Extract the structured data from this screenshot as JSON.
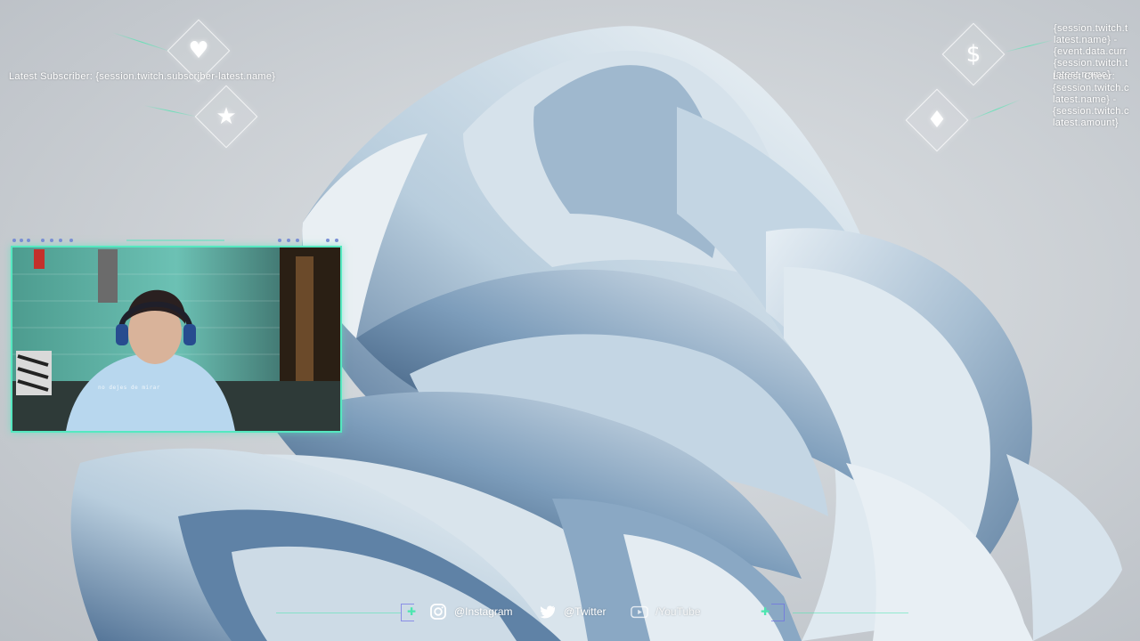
{
  "overlay": {
    "latest_subscriber": "Latest Subscriber: {session.twitch.subscriber-latest.name}",
    "top_right_lines": [
      "{session.twitch.t",
      "latest.name} -",
      "{event.data.curr",
      "{session.twitch.t",
      "latest.name}"
    ],
    "latest_cheer_lines": [
      "Latest Cheer:",
      "{session.twitch.c",
      "latest.name} -",
      "{session.twitch.c",
      "latest.amount}"
    ],
    "icons": {
      "follower": "heart-icon",
      "subscriber": "star-icon",
      "donation": "dollar-icon",
      "cheer": "diamond-icon",
      "follower_glyph": "♥",
      "subscriber_glyph": "★",
      "donation_glyph": "$",
      "cheer_glyph": "♦"
    }
  },
  "webcam": {
    "caption": "no dejes de mirar"
  },
  "socials": [
    {
      "icon": "instagram-icon",
      "label": "@Instagram"
    },
    {
      "icon": "twitter-icon",
      "label": "@Twitter"
    },
    {
      "icon": "youtube-icon",
      "label": "/YouTube"
    }
  ],
  "colors": {
    "accent": "#4de6b0",
    "webcam_border": "#55e8c0",
    "secondary_accent": "#6e6ee6",
    "text": "#ffffff",
    "background": "#c9cdd2",
    "ribbon": "#a9bfd3"
  }
}
